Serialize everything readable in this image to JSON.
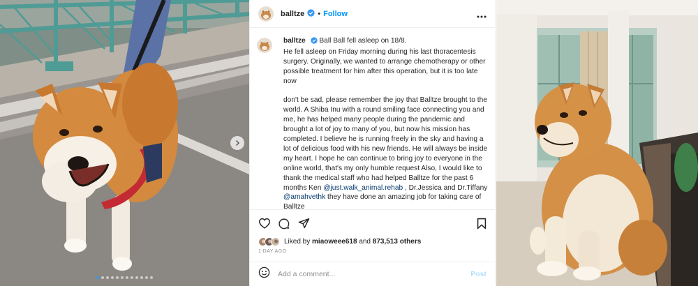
{
  "colors": {
    "accent": "#0095f6",
    "verified": "#3897f0",
    "mention": "#00376b",
    "muted": "#8e8e8e",
    "post_disabled": "#b2dffc"
  },
  "header": {
    "username": "balltze",
    "separator": "•",
    "follow_label": "Follow",
    "verified_icon": "verified-badge-icon",
    "more_icon": "more-options-icon"
  },
  "caption": {
    "username": "balltze",
    "headline": "Ball Ball fell asleep on 18/8.",
    "paragraph1": "He fell asleep on Friday morning during his last thoracentesis surgery. Originally, we wanted to arrange chemotherapy or other possible treatment for him after this operation, but it is too late now",
    "paragraph2_part1": "don't be sad, please remember the joy that Balltze brought to the world. A Shiba Inu with a round smiling face connecting you and me, he has helped many people during the pandemic and brought a lot of joy to many of you, but now his mission has completed. I believe he is running freely in the sky and having a lot of delicious food with his new friends. He will always be inside my heart. I hope he can continue to bring joy to everyone in the online world, that's my only humble request Also, I would like to thank the medical staff who had helped Balltze for the past 6 months Ken ",
    "mention1": "@just.walk_animal.rehab",
    "paragraph2_part2": " , Dr.Jessica and Dr.Tiffany",
    "mention2": "@amahvethk",
    "paragraph2_part3": " they have done an amazing job for taking care of Balltze"
  },
  "actions": {
    "like_icon": "heart-icon",
    "comment_icon": "comment-icon",
    "share_icon": "share-icon",
    "save_icon": "bookmark-icon"
  },
  "likes": {
    "prefix": "Liked by",
    "user": "miaoweee618",
    "connector": "and",
    "count": "873,513 others"
  },
  "timestamp": "1 DAY AGO",
  "comment": {
    "emoji_icon": "emoji-icon",
    "placeholder": "Add a comment...",
    "post_label": "Post"
  },
  "carousel": {
    "slide_count": 12,
    "active_index": 0,
    "next_icon": "chevron-right-icon"
  }
}
